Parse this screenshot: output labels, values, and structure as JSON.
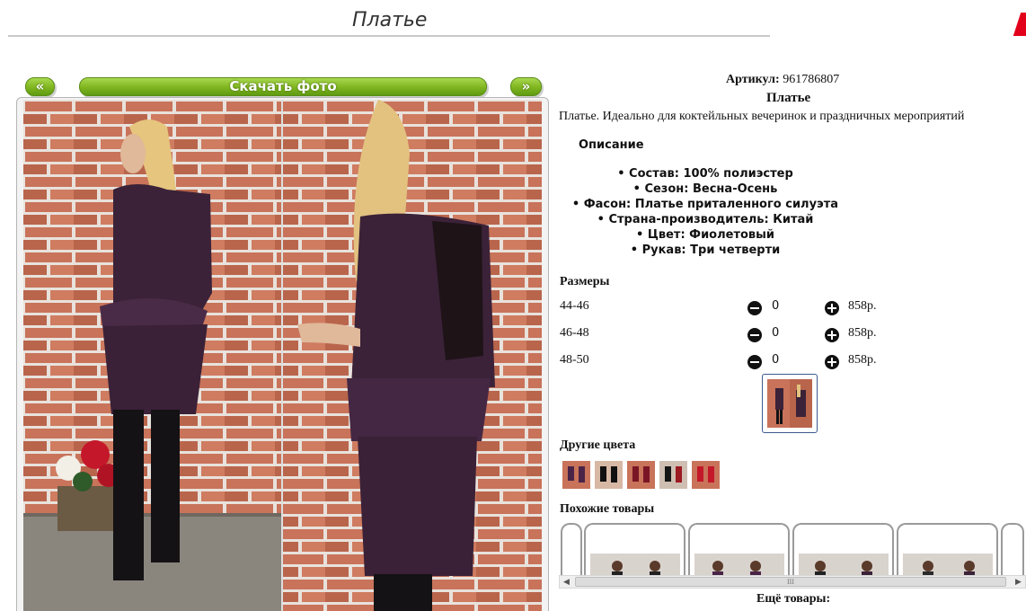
{
  "page": {
    "title": "Платье"
  },
  "gallery": {
    "prev_label": "«",
    "download_label": "Скачать фото",
    "next_label": "»"
  },
  "product": {
    "article_label": "Артикул:",
    "article_value": "961786807",
    "name": "Платье",
    "description": "Платье. Идеально для коктейльных вечеринок и праздничных мероприятий",
    "description_heading": "Описание",
    "features": [
      "Состав: 100% полиэстер",
      "Сезон: Весна-Осень",
      "Фасон: Платье приталенного силуэта",
      "Страна-производитель: Китай",
      "Цвет: Фиолетовый",
      "Рукав: Три четверти"
    ]
  },
  "sizes": {
    "heading": "Размеры",
    "rows": [
      {
        "label": "44-46",
        "qty": "0",
        "price": "858р."
      },
      {
        "label": "46-48",
        "qty": "0",
        "price": "858р."
      },
      {
        "label": "48-50",
        "qty": "0",
        "price": "858р."
      }
    ]
  },
  "other_colors": {
    "heading": "Другие цвета",
    "swatches": [
      "purple",
      "black",
      "burgundy",
      "black-red",
      "red"
    ]
  },
  "similar": {
    "heading": "Похожие товары"
  },
  "scrollbar": {
    "left": "◀",
    "grip": "III",
    "right": "▶"
  },
  "more": {
    "label": "Ещё товары:"
  },
  "colors": {
    "button_green": "#7fb51f",
    "dress_purple": "#3b2238",
    "brick": "#c26b50"
  }
}
